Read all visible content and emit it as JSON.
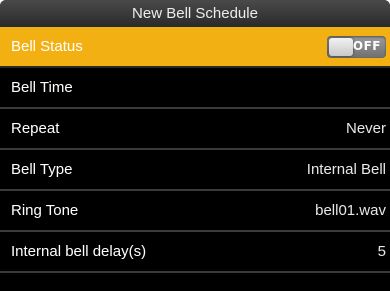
{
  "header": {
    "title": "New Bell Schedule"
  },
  "settings": [
    {
      "label": "Bell Status",
      "value": "OFF",
      "control": "toggle",
      "selected": true
    },
    {
      "label": "Bell Time",
      "value": ""
    },
    {
      "label": "Repeat",
      "value": "Never"
    },
    {
      "label": "Bell Type",
      "value": "Internal Bell"
    },
    {
      "label": "Ring Tone",
      "value": "bell01.wav"
    },
    {
      "label": "Internal bell delay(s)",
      "value": "5"
    }
  ],
  "colors": {
    "highlight": "#f3b012",
    "background": "#000000"
  }
}
